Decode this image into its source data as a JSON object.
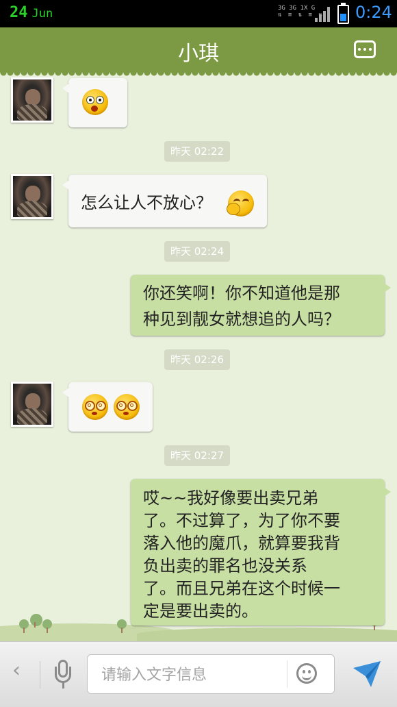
{
  "status_bar": {
    "date_day": "24",
    "date_month": "Jun",
    "network_labels": [
      "3G",
      "3G 1X",
      "G"
    ],
    "battery_level_percent": 45,
    "time": "0:24",
    "colors": {
      "date": "#2ad12a",
      "time": "#3b9bff"
    }
  },
  "header": {
    "title": "小琪",
    "menu_icon": "more-dots-icon",
    "background": "#7c9a44"
  },
  "messages": [
    {
      "sender": "contact",
      "type": "emoji",
      "emoji": [
        "surprised-emoji"
      ]
    },
    {
      "type": "timestamp",
      "text": "昨天 02:22"
    },
    {
      "sender": "contact",
      "type": "text",
      "text": "怎么让人不放心？",
      "emoji": [
        "laughing-emoji"
      ]
    },
    {
      "type": "timestamp",
      "text": "昨天 02:24"
    },
    {
      "sender": "self",
      "type": "text",
      "lines": [
        "你还笑啊！你不知道他是那",
        "种见到靓女就想追的人吗？"
      ]
    },
    {
      "type": "timestamp",
      "text": "昨天 02:26"
    },
    {
      "sender": "contact",
      "type": "emoji",
      "emoji": [
        "dizzy-emoji",
        "dizzy-emoji"
      ]
    },
    {
      "type": "timestamp",
      "text": "昨天 02:27"
    },
    {
      "sender": "self",
      "type": "text",
      "lines": [
        "哎~~我好像要出卖兄弟",
        "了。不过算了，为了你不要",
        "落入他的魔爪，就算要我背",
        "负出卖的罪名也没关系",
        "了。而且兄弟在这个时候一",
        "定是要出卖的。"
      ]
    }
  ],
  "input_bar": {
    "back_icon": "chevron-left-icon",
    "voice_icon": "microphone-icon",
    "placeholder": "请输入文字信息",
    "value": "",
    "emoji_icon": "smiley-icon",
    "send_icon": "send-icon",
    "send_color": "#3a8fd8"
  }
}
